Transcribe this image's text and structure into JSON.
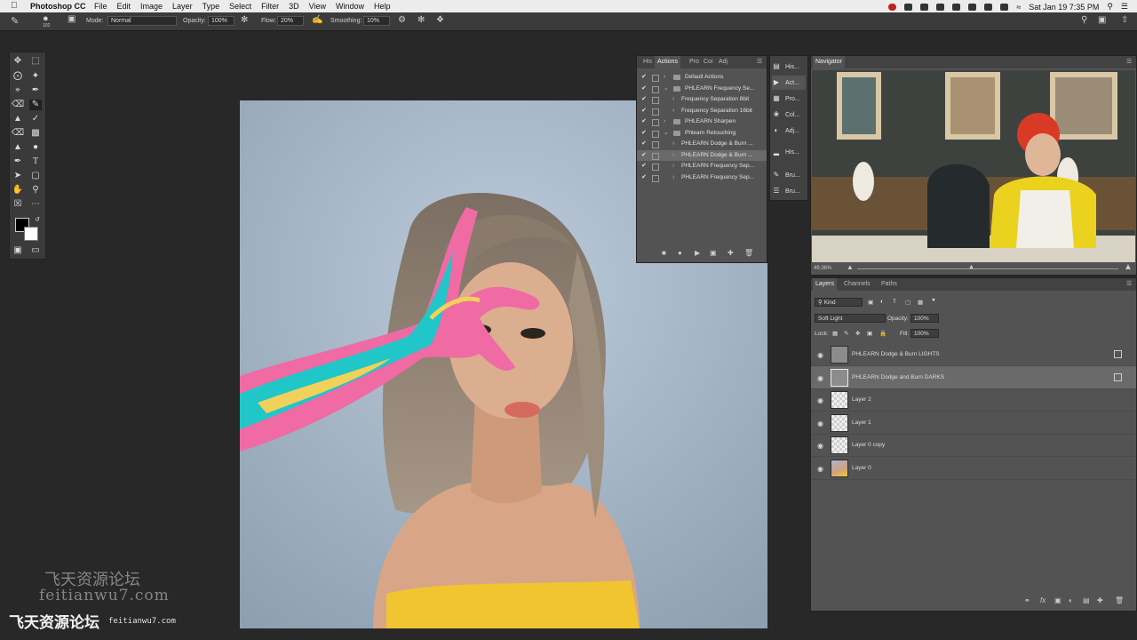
{
  "menubar": {
    "app_name": "Photoshop CC",
    "menus": [
      "File",
      "Edit",
      "Image",
      "Layer",
      "Type",
      "Select",
      "Filter",
      "3D",
      "View",
      "Window",
      "Help"
    ],
    "clock": "Sat Jan 19  7:35 PM"
  },
  "options_bar": {
    "brush_size": "102",
    "mode_label": "Mode:",
    "mode_value": "Normal",
    "opacity_label": "Opacity:",
    "opacity_value": "100%",
    "flow_label": "Flow:",
    "flow_value": "20%",
    "smoothing_label": "Smoothing:",
    "smoothing_value": "10%"
  },
  "actions_panel": {
    "tabs": [
      "His",
      "Actions",
      "Pro",
      "Coi",
      "Adj"
    ],
    "active_tab": "Actions",
    "rows": [
      {
        "label": "Default Actions",
        "kind": "set",
        "expanded": false
      },
      {
        "label": "PHLEARN Frequency Se...",
        "kind": "set",
        "expanded": true
      },
      {
        "label": "Frequency Separation 8bit",
        "kind": "action"
      },
      {
        "label": "Frequency Separation 16bit",
        "kind": "action"
      },
      {
        "label": "PHLEARN Sharpen",
        "kind": "set",
        "expanded": false
      },
      {
        "label": "Phlearn Retouching",
        "kind": "set",
        "expanded": true
      },
      {
        "label": "PHLEARN Dodge & Burn ...",
        "kind": "action"
      },
      {
        "label": "PHLEARN Dodge & Burn ...",
        "kind": "action",
        "selected": true
      },
      {
        "label": "PHLEARN Frequency Sep...",
        "kind": "action"
      },
      {
        "label": "PHLEARN Frequency Sep...",
        "kind": "action"
      }
    ]
  },
  "dock": {
    "items": [
      "His...",
      "Act...",
      "Pro...",
      "Col...",
      "Adj...",
      "His...",
      "Bru...",
      "Bru..."
    ]
  },
  "navigator": {
    "title": "Navigator",
    "zoom": "49.36%"
  },
  "layers_panel": {
    "tabs": [
      "Layers",
      "Channels",
      "Paths"
    ],
    "filter_value": "Kind",
    "blend_mode": "Soft Light",
    "opacity_label": "Opacity:",
    "opacity_value": "100%",
    "lock_label": "Lock:",
    "fill_label": "Fill:",
    "fill_value": "100%",
    "layers": [
      {
        "name": "PHLEARN Dodge & Burn LIGHTS",
        "thumb": "gray",
        "link": true
      },
      {
        "name": "PHLEARN Dodge and Burn DARKS",
        "thumb": "gray",
        "link": true,
        "selected": true
      },
      {
        "name": "Layer 2",
        "thumb": "checker"
      },
      {
        "name": "Layer 1",
        "thumb": "checker"
      },
      {
        "name": "Layer 0 copy",
        "thumb": "checker"
      },
      {
        "name": "Layer 0",
        "thumb": "photo"
      }
    ]
  },
  "watermark": {
    "line1": "飞天资源论坛",
    "line2": "feitianwu7.com",
    "brand": "飞天资源论坛",
    "brand_url": "feitianwu7.com"
  },
  "colors": {
    "foreground": "#000000",
    "background": "#ffffff",
    "panel": "#535353",
    "canvas_bg": "#a8b9ca",
    "skin": "#d9a98c",
    "sweater": "#f0c530",
    "paint_pink": "#f06aa4",
    "paint_cyan": "#21c6c8"
  }
}
